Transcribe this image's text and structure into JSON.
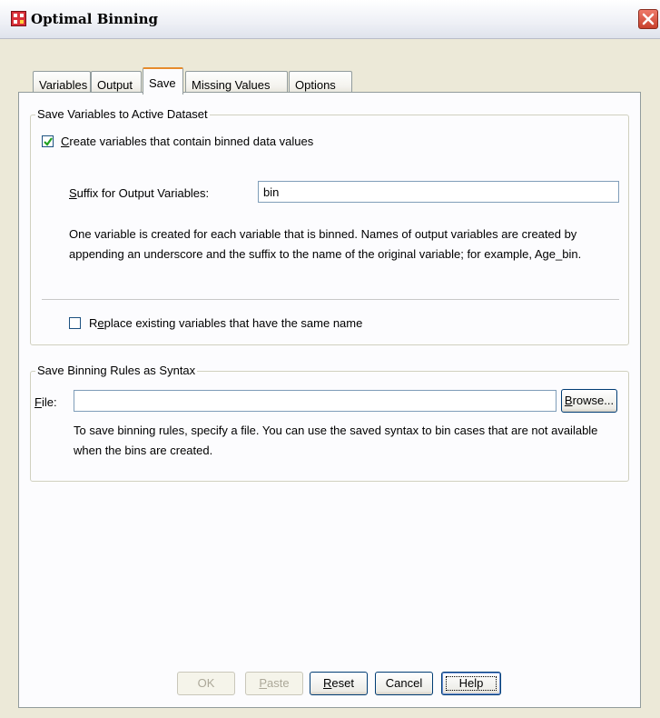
{
  "window": {
    "title": "Optimal Binning",
    "app_icon": "grid-icon",
    "close_icon": "close-icon"
  },
  "tabs": [
    {
      "label": "Variables",
      "active": false
    },
    {
      "label": "Output",
      "active": false
    },
    {
      "label": "Save",
      "active": true
    },
    {
      "label": "Missing Values",
      "active": false
    },
    {
      "label": "Options",
      "active": false
    }
  ],
  "save_variables": {
    "legend": "Save Variables to Active Dataset",
    "create_checkbox": {
      "accel": "C",
      "label_rest": "reate variables that contain binned data values",
      "checked": true
    },
    "suffix": {
      "accel": "S",
      "label_rest": "uffix for Output Variables:",
      "value": "bin"
    },
    "description": "One variable is created for each variable that is binned. Names of output variables are created by appending an underscore and the suffix to the name of the original variable; for example, Age_bin.",
    "replace_checkbox": {
      "label_pre": "R",
      "accel": "e",
      "label_rest": "place existing variables that have the same name",
      "checked": false
    }
  },
  "save_syntax": {
    "legend": "Save Binning Rules as Syntax",
    "file_label": {
      "accel": "F",
      "rest": "ile:"
    },
    "file_value": "",
    "browse": {
      "accel": "B",
      "rest": "rowse..."
    },
    "description": "To save binning rules, specify a file. You can use the saved syntax to bin cases that are not available when the bins are created."
  },
  "buttons": {
    "ok": "OK",
    "paste": {
      "accel": "P",
      "rest": "aste"
    },
    "reset": {
      "accel": "R",
      "rest": "eset"
    },
    "cancel": "Cancel",
    "help": "Help"
  },
  "colors": {
    "accent_tab": "#e68b2c",
    "close_button": "#c8402c",
    "checkmark": "#21a121"
  }
}
